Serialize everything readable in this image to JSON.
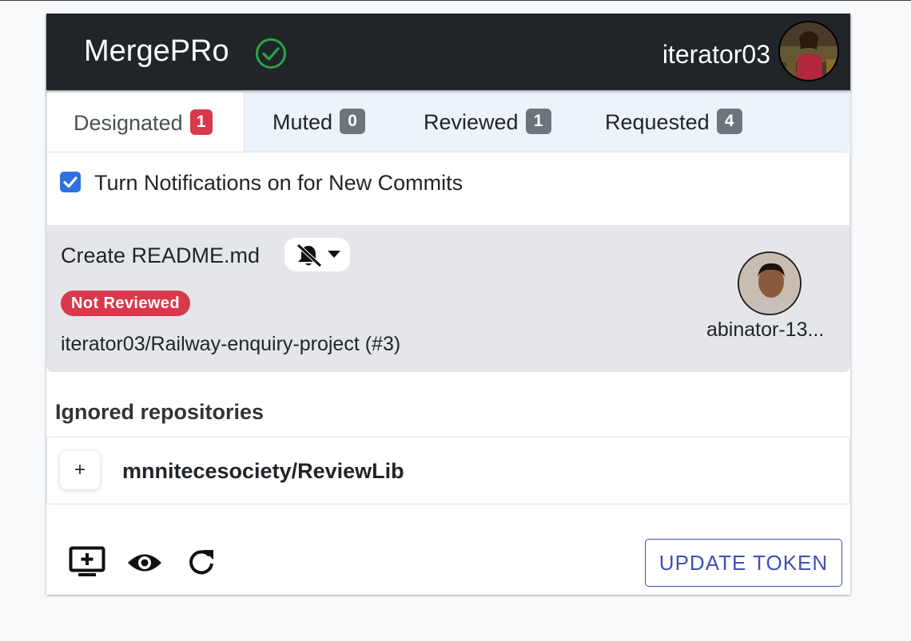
{
  "header": {
    "brand": "MergePRo",
    "username": "iterator03"
  },
  "tabs": [
    {
      "label": "Designated",
      "count": "1",
      "active": true
    },
    {
      "label": "Muted",
      "count": "0"
    },
    {
      "label": "Reviewed",
      "count": "1"
    },
    {
      "label": "Requested",
      "count": "4"
    }
  ],
  "notifications": {
    "label": "Turn Notifications on for New Commits",
    "checked": true
  },
  "pull_request": {
    "title": "Create README.md",
    "status": "Not Reviewed",
    "repo": "iterator03/Railway-enquiry-project (#3)",
    "reviewer": "abinator-13..."
  },
  "ignored": {
    "heading": "Ignored repositories",
    "add_label": "+",
    "items": [
      "mnnitecesociety/ReviewLib"
    ]
  },
  "footer": {
    "update_label": "UPDATE TOKEN"
  },
  "colors": {
    "header_bg": "#212529",
    "danger": "#d9394a",
    "badge_gray": "#6c757d",
    "check_green": "#28a745",
    "primary_outline": "#3f51b5"
  },
  "icons": [
    "check-circle-icon",
    "bell-slash-icon",
    "caret-down-icon",
    "add-to-screen-icon",
    "eye-icon",
    "refresh-icon"
  ]
}
